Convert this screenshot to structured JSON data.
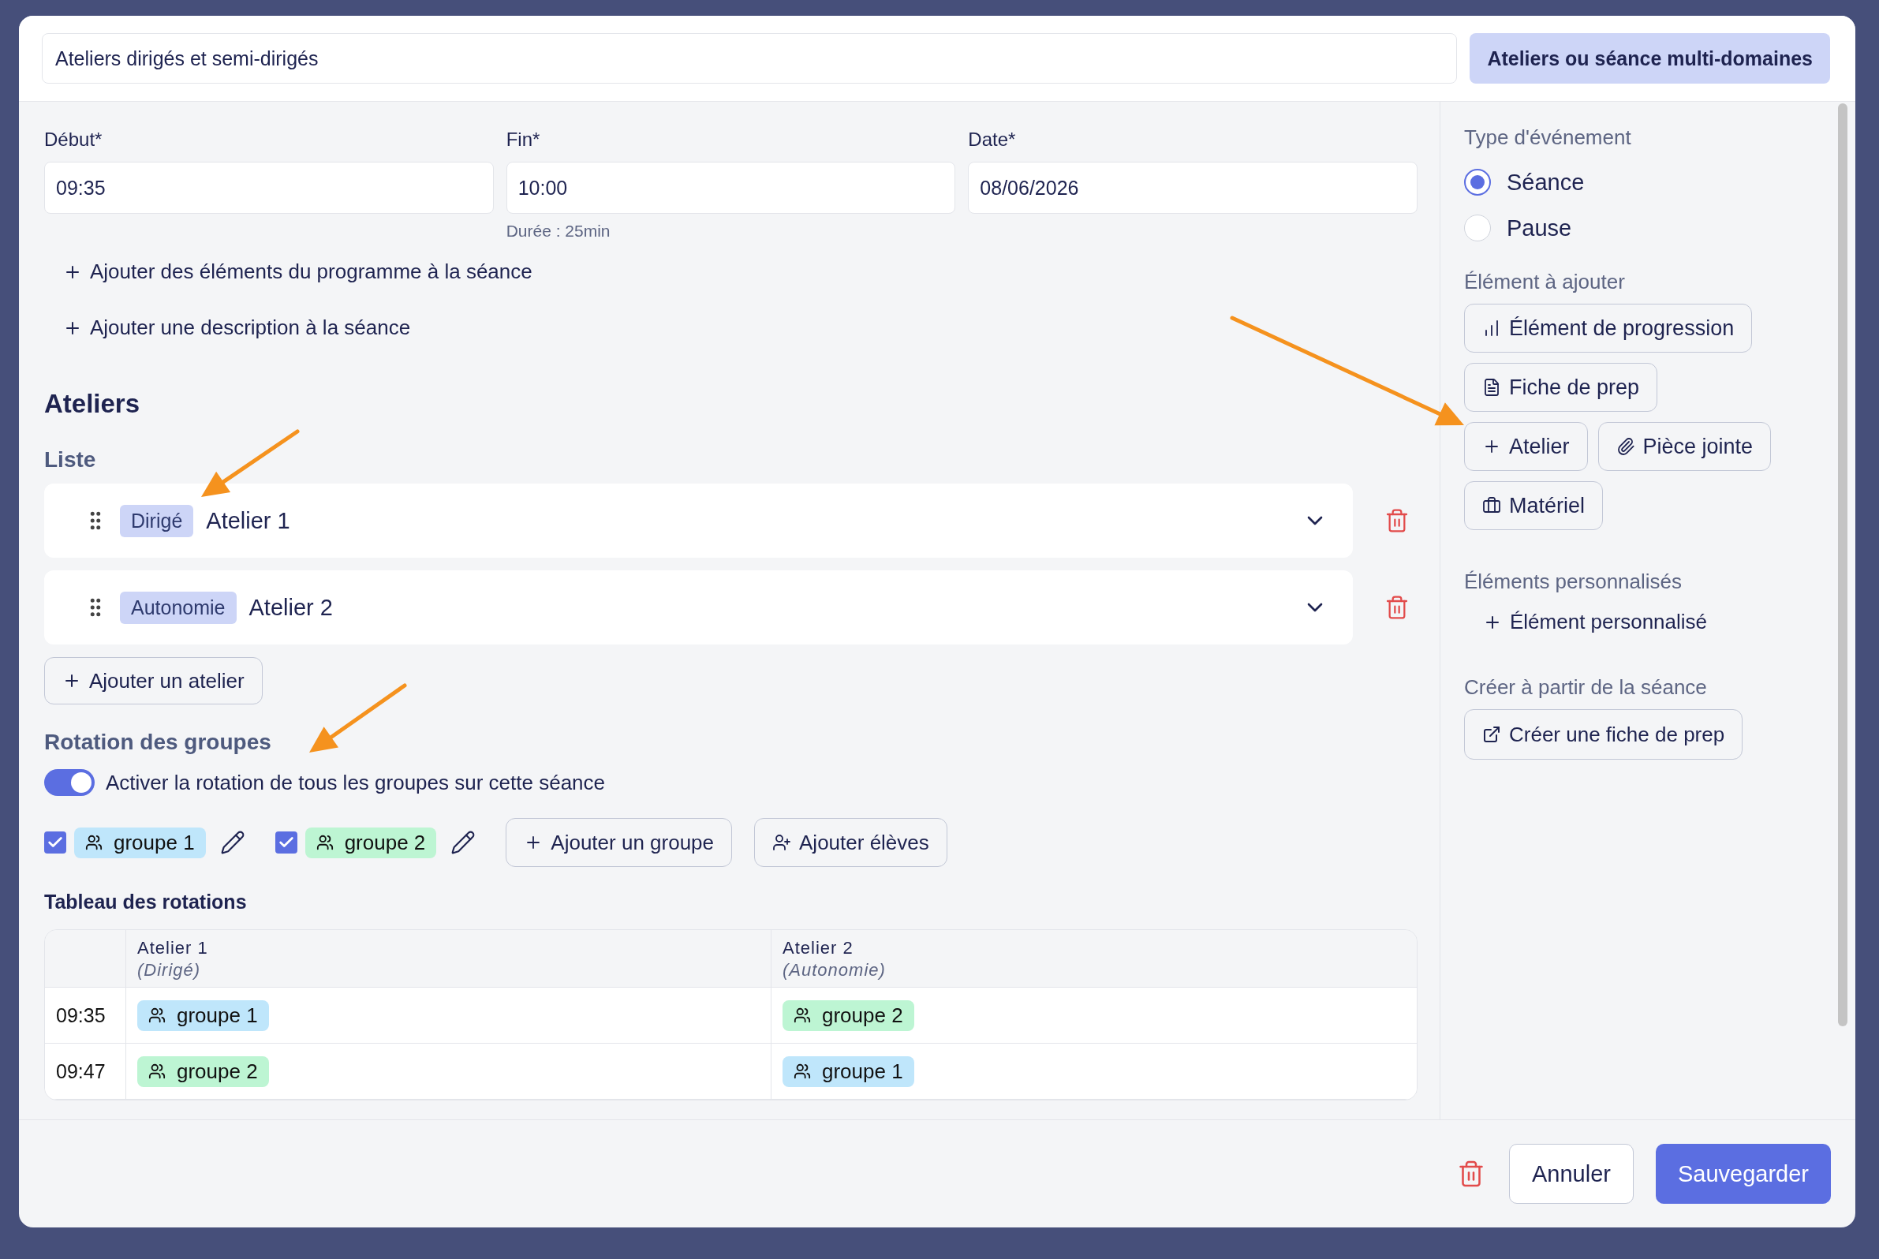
{
  "header": {
    "title_field": {
      "value": "Ateliers dirigés et semi-dirigés"
    },
    "button": "Ateliers ou séance multi-domaines"
  },
  "time_fields": [
    {
      "label": "Début*",
      "value": "09:35"
    },
    {
      "label": "Fin*",
      "value": "10:00",
      "hint": "Durée : 25min"
    },
    {
      "label": "Date*",
      "value": "08/06/2026"
    }
  ],
  "add_links": [
    "Ajouter des éléments du programme à la séance",
    "Ajouter une description à la séance"
  ],
  "section_title": "Ateliers",
  "list_label": "Liste",
  "ateliers": [
    {
      "tag": "Dirigé",
      "name": "Atelier 1"
    },
    {
      "tag": "Autonomie",
      "name": "Atelier 2"
    }
  ],
  "add_atelier_button": "Ajouter un atelier",
  "rotation": {
    "title": "Rotation des groupes",
    "toggle": {
      "label": "Activer la rotation de tous les groupes sur cette séance",
      "on": true
    },
    "groups": [
      {
        "name": "groupe 1",
        "checked": true,
        "color": "#bfe6fb"
      },
      {
        "name": "groupe 2",
        "checked": true,
        "color": "#bdf5d3"
      }
    ],
    "buttons": [
      {
        "label": "Ajouter un groupe",
        "kind": "add"
      },
      {
        "label": "Ajouter élèves",
        "kind": "students"
      }
    ]
  },
  "rotation_table": {
    "title": "Tableau des rotations",
    "columns": [
      {
        "name": "Atelier 1",
        "subtitle": "(Dirigé)"
      },
      {
        "name": "Atelier 2",
        "subtitle": "(Autonomie)"
      }
    ],
    "rows": [
      {
        "time": "09:35",
        "cells": [
          {
            "group": "groupe 1",
            "color": "#bfe6fb"
          },
          {
            "group": "groupe 2",
            "color": "#bdf5d3"
          }
        ]
      },
      {
        "time": "09:47",
        "cells": [
          {
            "group": "groupe 2",
            "color": "#bdf5d3"
          },
          {
            "group": "groupe 1",
            "color": "#bfe6fb"
          }
        ]
      }
    ]
  },
  "sidebar": {
    "event_type": {
      "label": "Type d'événement",
      "options": [
        {
          "label": "Séance",
          "selected": true
        },
        {
          "label": "Pause",
          "selected": false
        }
      ]
    },
    "elements": {
      "label": "Élément à ajouter",
      "buttons": [
        {
          "label": "Élément de progression",
          "kind": "progression"
        },
        {
          "label": "Fiche de prep",
          "kind": "sheet"
        },
        {
          "label": "Atelier",
          "kind": "add"
        },
        {
          "label": "Pièce jointe",
          "kind": "attachment"
        },
        {
          "label": "Matériel",
          "kind": "material"
        }
      ]
    },
    "custom": {
      "label": "Éléments personnalisés",
      "button": "Élément personnalisé"
    },
    "create": {
      "label": "Créer à partir de la séance",
      "button": "Créer une fiche de prep"
    }
  },
  "footer": {
    "cancel": "Annuler",
    "save": "Sauvegarder"
  }
}
